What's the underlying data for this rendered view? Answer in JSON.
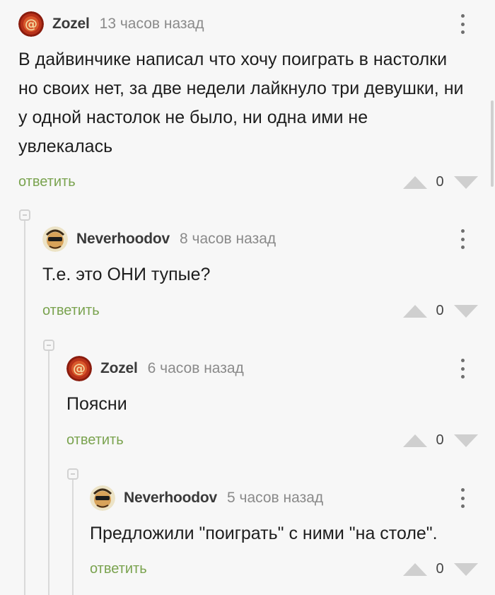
{
  "comments": [
    {
      "author": "Zozel",
      "time": "13 часов назад",
      "text": "В дайвинчике написал что хочу поиграть в настолки но своих нет, за две недели лайкнуло три девушки, ни у одной настолок не было, ни одна ими не увлекалась",
      "reply_label": "ответить",
      "score": "0",
      "avatar_icon": "at-sign-avatar"
    },
    {
      "author": "Neverhoodov",
      "time": "8 часов назад",
      "text": "Т.е. это ОНИ тупые?",
      "reply_label": "ответить",
      "score": "0",
      "avatar_icon": "sunglasses-avatar"
    },
    {
      "author": "Zozel",
      "time": "6 часов назад",
      "text": "Поясни",
      "reply_label": "ответить",
      "score": "0",
      "avatar_icon": "at-sign-avatar"
    },
    {
      "author": "Neverhoodov",
      "time": "5 часов назад",
      "text": "Предложили \"поиграть\" с ними \"на столе\".",
      "reply_label": "ответить",
      "score": "0",
      "avatar_icon": "sunglasses-avatar"
    }
  ],
  "colors": {
    "reply": "#7aa34f",
    "background": "#f7f7f7",
    "thread_line": "#dadada",
    "vote_arrow": "#cfcfcf"
  }
}
